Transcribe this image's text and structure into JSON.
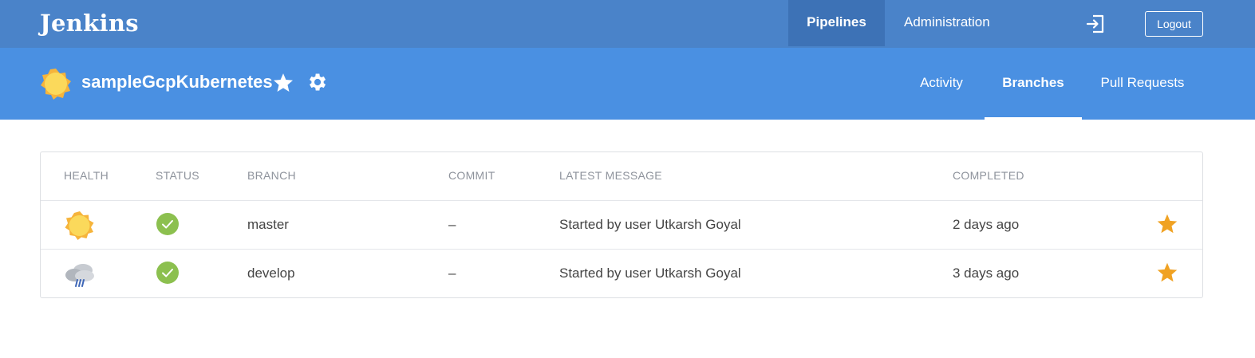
{
  "app": {
    "logo": "Jenkins"
  },
  "topnav": {
    "pipelines_label": "Pipelines",
    "administration_label": "Administration",
    "login_icon": "sign-in-icon",
    "logout_label": "Logout"
  },
  "pipeline": {
    "name": "sampleGcpKubernetes",
    "health_icon": "sunny-icon",
    "favorite_icon": "star-icon",
    "settings_icon": "gear-icon"
  },
  "subtabs": [
    {
      "label": "Activity",
      "active": false
    },
    {
      "label": "Branches",
      "active": true
    },
    {
      "label": "Pull Requests",
      "active": false
    }
  ],
  "table": {
    "headers": [
      "HEALTH",
      "STATUS",
      "BRANCH",
      "COMMIT",
      "LATEST MESSAGE",
      "COMPLETED"
    ],
    "rows": [
      {
        "health": "sunny-icon",
        "status": "success-check-icon",
        "branch": "master",
        "commit": "–",
        "message": "Started by user Utkarsh Goyal",
        "completed": "2 days ago",
        "favorite": true
      },
      {
        "health": "rainy-cloud-icon",
        "status": "success-check-icon",
        "branch": "develop",
        "commit": "–",
        "message": "Started by user Utkarsh Goyal",
        "completed": "3 days ago",
        "favorite": true
      }
    ]
  },
  "colors": {
    "topbar": "#4a83c9",
    "topbar_active": "#3d72b6",
    "subbar": "#4a90e2",
    "success": "#8cc04f",
    "favorite_star": "#f0a223",
    "sun": "#fbd95b"
  }
}
